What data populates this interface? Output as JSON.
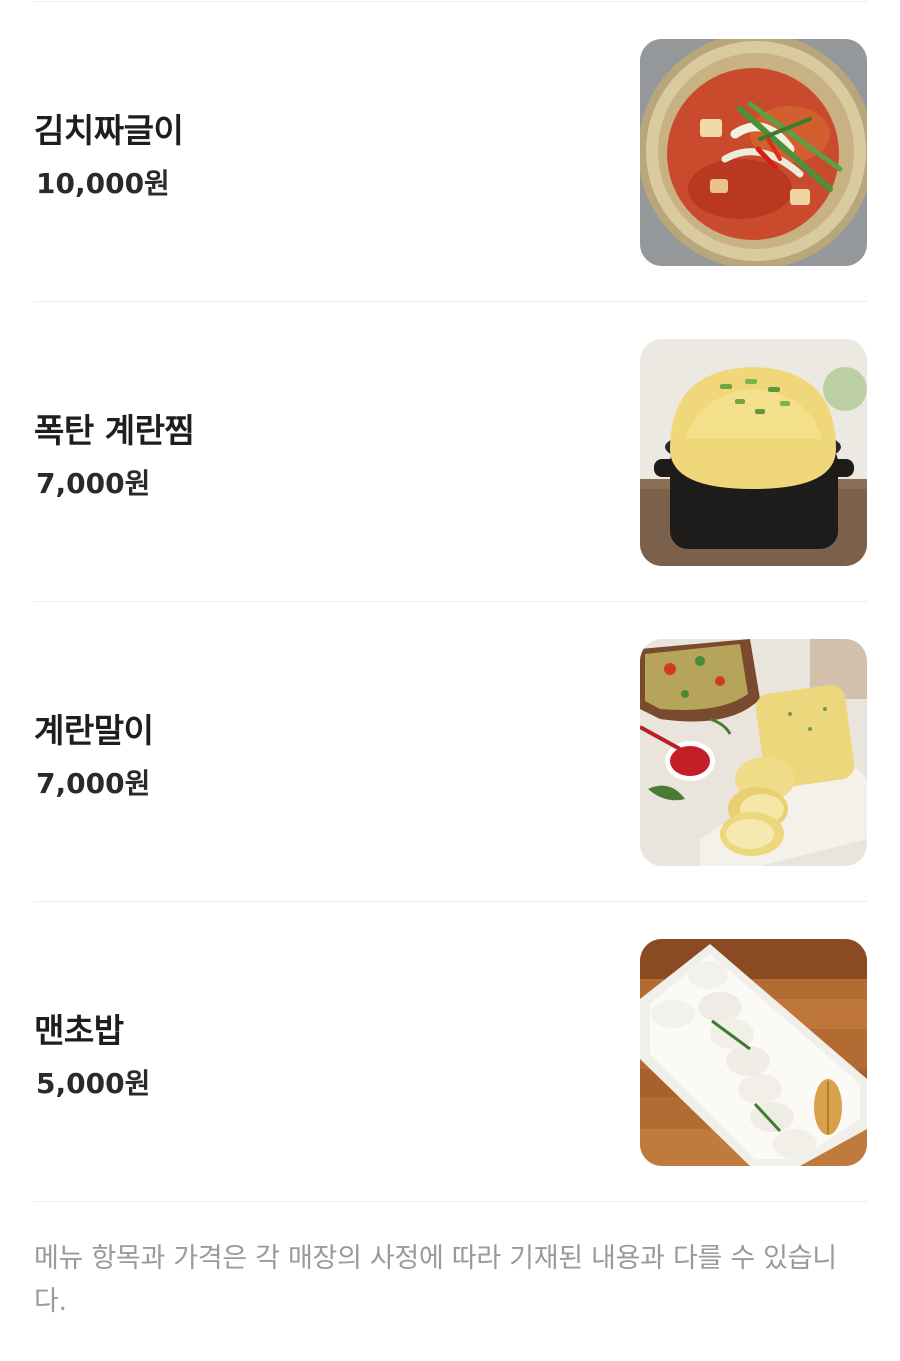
{
  "menu": {
    "items": [
      {
        "name": "김치짜글이",
        "price": "10,000원",
        "photo_icon": "kimchi-stew-photo"
      },
      {
        "name": "폭탄 계란찜",
        "price": "7,000원",
        "photo_icon": "steamed-egg-photo"
      },
      {
        "name": "계란말이",
        "price": "7,000원",
        "photo_icon": "rolled-omelette-photo"
      },
      {
        "name": "맨초밥",
        "price": "5,000원",
        "photo_icon": "plain-rice-ball-photo"
      }
    ]
  },
  "footer": {
    "notice": "메뉴 항목과 가격은 각 매장의 사정에 따라 기재된 내용과 다를 수 있습니다."
  },
  "colors": {
    "background": "#ffffff",
    "divider": "#ececec",
    "text_primary": "#1e1e1e",
    "text_secondary": "#9a9a9a"
  }
}
